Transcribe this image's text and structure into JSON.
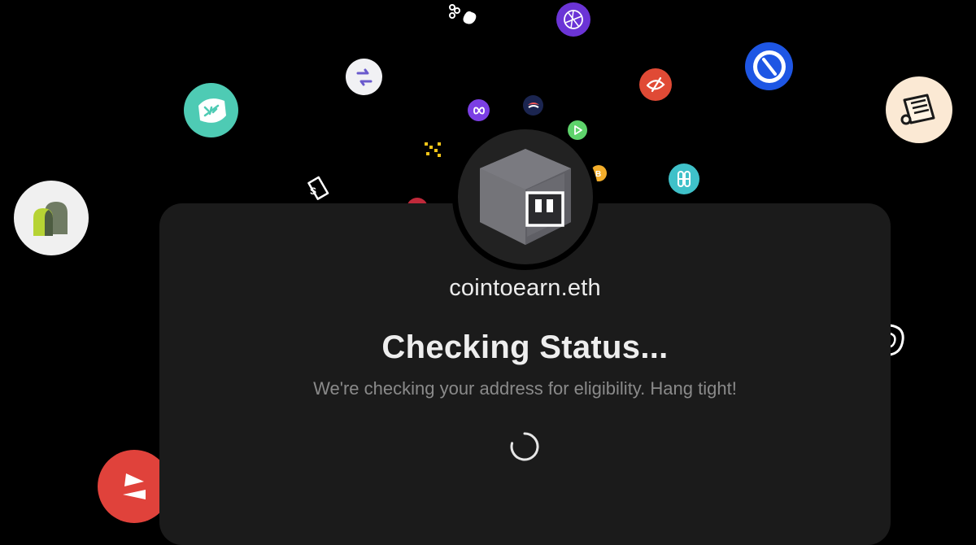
{
  "profile": {
    "ens_name": "cointoearn.eth"
  },
  "status": {
    "title": "Checking Status...",
    "message": "We're checking your address for eligibility. Hang tight!"
  },
  "spinner": {
    "icon": "loading-spinner-icon",
    "color": "#e6e6e6"
  },
  "colors": {
    "background": "#000000",
    "card": "#1b1b1b",
    "title_text": "#eeeeee",
    "subtitle_text": "#8a8a8a"
  },
  "floating_icons": [
    "chain-links-icon",
    "globe-network-icon",
    "swap-arrows-icon",
    "pie-clock-icon",
    "spiral-icon",
    "scroll-document-icon",
    "island-leaf-icon",
    "infinity-link-icon",
    "bull-icon",
    "play-icon",
    "dotted-x-icon",
    "ticket-icon",
    "coin-b-icon",
    "pill-capsule-icon",
    "arch-logo-icon",
    "at-ring-icon",
    "red-triangle-icon"
  ]
}
